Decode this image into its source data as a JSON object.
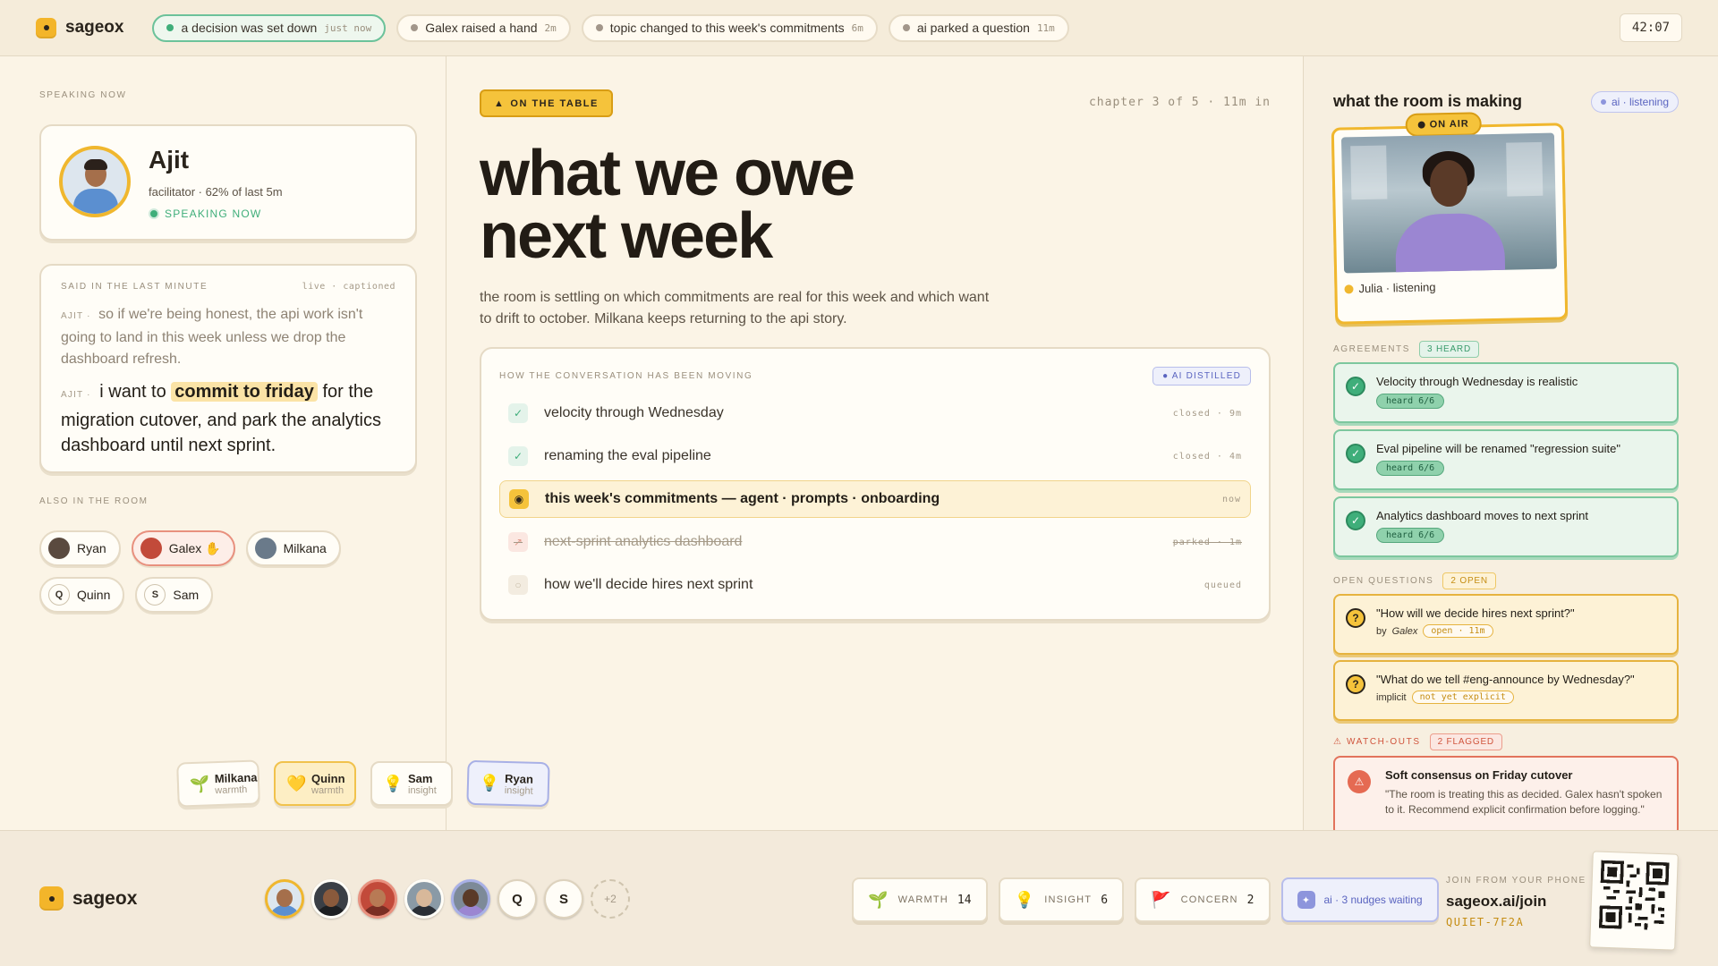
{
  "app": {
    "name": "sageox",
    "timer": "42:07"
  },
  "events": [
    {
      "text": "a decision was set down",
      "ago": "just now",
      "active": true
    },
    {
      "text": "Galex raised a hand",
      "ago": "2m",
      "active": false
    },
    {
      "text": "topic changed to this week's commitments",
      "ago": "6m",
      "active": false
    },
    {
      "text": "ai parked a question",
      "ago": "11m",
      "active": false
    }
  ],
  "speaker": {
    "section_label": "SPEAKING NOW",
    "name": "Ajit",
    "role": "facilitator · 62% of last 5m",
    "status": "SPEAKING NOW"
  },
  "captions": {
    "label": "SAID IN THE LAST MINUTE",
    "meta": "live · captioned",
    "older": {
      "who": "AJIT ·",
      "text": "so if we're being honest, the api work isn't going to land in this week unless we drop the dashboard refresh."
    },
    "latest": {
      "who": "AJIT ·",
      "before": "i want to",
      "highlight": "commit to friday",
      "after": "for the migration cutover, and park the analytics dashboard until next sprint."
    }
  },
  "room": {
    "label": "ALSO IN THE ROOM",
    "people": [
      {
        "name": "Ryan",
        "initial": "",
        "raised": false
      },
      {
        "name": "Galex ✋",
        "initial": "",
        "raised": true
      },
      {
        "name": "Milkana",
        "initial": "",
        "raised": false
      },
      {
        "name": "Quinn",
        "initial": "Q",
        "raised": false
      },
      {
        "name": "Sam",
        "initial": "S",
        "raised": false
      }
    ]
  },
  "reactions": [
    {
      "name": "Milkana",
      "kind": "warmth",
      "icon": "🌱",
      "style": "plain"
    },
    {
      "name": "Quinn",
      "kind": "warmth",
      "icon": "💛",
      "style": "yellow"
    },
    {
      "name": "Sam",
      "kind": "insight",
      "icon": "💡",
      "style": "plain"
    },
    {
      "name": "Ryan",
      "kind": "insight",
      "icon": "💡",
      "style": "blue"
    }
  ],
  "topic": {
    "tag": "ON THE TABLE",
    "chapter": "chapter 3 of 5 · 11m in",
    "title_line1": "what we owe",
    "title_line2": "next week",
    "summary": "the room is settling on which commitments are real for this week and which want to drift to october. Milkana keeps returning to the api story."
  },
  "flow": {
    "label": "HOW THE CONVERSATION HAS BEEN MOVING",
    "badge": "● AI DISTILLED",
    "items": [
      {
        "text": "velocity through Wednesday",
        "status": "closed · 9m",
        "state": "done",
        "icon": "✓"
      },
      {
        "text": "renaming the eval pipeline",
        "status": "closed · 4m",
        "state": "done",
        "icon": "✓"
      },
      {
        "text": "this week's commitments — agent · prompts · onboarding",
        "status": "now",
        "state": "now",
        "icon": "◉"
      },
      {
        "text": "next-sprint analytics dashboard",
        "status": "parked · 1m",
        "state": "park",
        "icon": "↗"
      },
      {
        "text": "how we'll decide hires next sprint",
        "status": "queued",
        "state": "queue",
        "icon": "○"
      }
    ]
  },
  "right": {
    "title": "what the room is making",
    "listen_badge": "ai · listening",
    "on_air": "ON AIR",
    "video_label": "Julia · listening",
    "agreements_label": "AGREEMENTS",
    "agreements_count": "3 HEARD",
    "agreements": [
      {
        "text": "Velocity through Wednesday is realistic",
        "heard": "heard 6/6"
      },
      {
        "text": "Eval pipeline will be renamed \"regression suite\"",
        "heard": "heard 6/6"
      },
      {
        "text": "Analytics dashboard moves to next sprint",
        "heard": "heard 6/6"
      }
    ],
    "questions_label": "OPEN QUESTIONS",
    "questions_count": "2 OPEN",
    "questions": [
      {
        "text": "\"How will we decide hires next sprint?\"",
        "by_prefix": "by",
        "by": "Galex",
        "pill": "open · 11m"
      },
      {
        "text": "\"What do we tell #eng-announce by Wednesday?\"",
        "by_prefix": "",
        "by": "implicit",
        "pill": "not yet explicit"
      }
    ],
    "watch_label": "⚠ WATCH-OUTS",
    "watch_count": "2 FLAGGED",
    "watch": {
      "title": "Soft consensus on Friday cutover",
      "body": "\"The room is treating this as decided. Galex hasn't spoken to it. Recommend explicit confirmation before logging.\""
    }
  },
  "footer": {
    "brand": "sageox",
    "avatars": [
      {
        "kind": "photo",
        "initial": ""
      },
      {
        "kind": "photo",
        "initial": ""
      },
      {
        "kind": "photo",
        "initial": ""
      },
      {
        "kind": "photo",
        "initial": ""
      },
      {
        "kind": "photo",
        "initial": ""
      },
      {
        "kind": "letter",
        "initial": "Q"
      },
      {
        "kind": "letter",
        "initial": "S"
      },
      {
        "kind": "more",
        "initial": "+2"
      }
    ],
    "counters": [
      {
        "label": "WARMTH",
        "value": "14",
        "icon": "🌱"
      },
      {
        "label": "INSIGHT",
        "value": "6",
        "icon": "💡"
      },
      {
        "label": "CONCERN",
        "value": "2",
        "icon": "🚩"
      }
    ],
    "ai_nudges": "ai · 3 nudges waiting",
    "join_label": "JOIN FROM YOUR PHONE",
    "join_url": "sageox.ai/join",
    "join_code": "QUIET-7F2A"
  }
}
